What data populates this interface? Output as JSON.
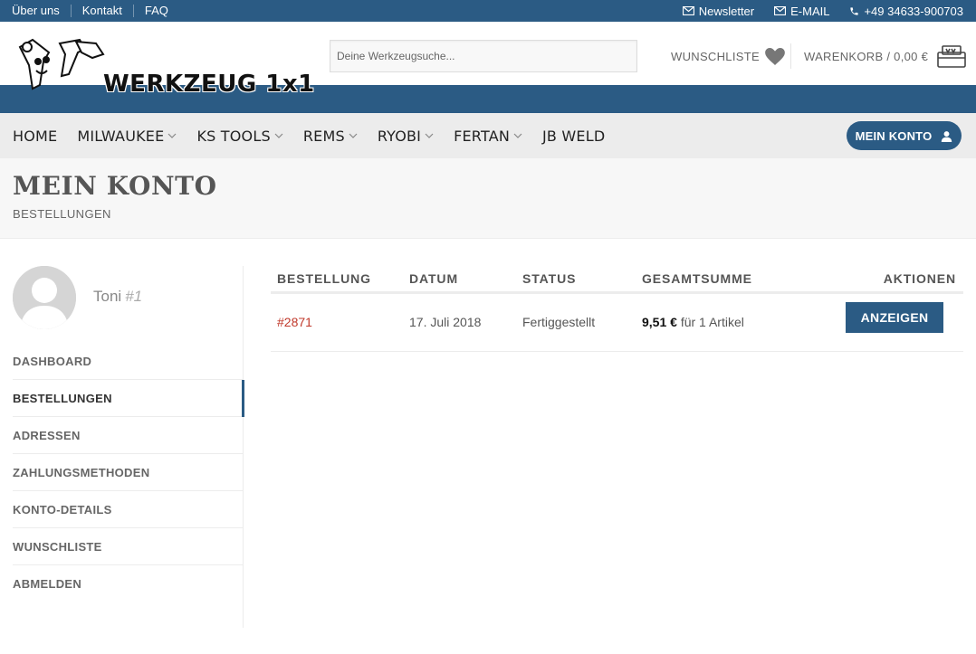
{
  "topbar": {
    "links": [
      "Über uns",
      "Kontakt",
      "FAQ"
    ],
    "newsletter": "Newsletter",
    "email": "E-MAIL",
    "phone": "+49 34633-900703"
  },
  "header": {
    "logo_text": "WERKZEUG 1x1",
    "search_placeholder": "Deine Werkzeugsuche...",
    "wishlist_label": "WUNSCHLISTE",
    "cart_label": "WARENKORB / 0,00 €"
  },
  "nav": {
    "items": [
      {
        "label": "HOME",
        "has_dropdown": false
      },
      {
        "label": "MILWAUKEE",
        "has_dropdown": true
      },
      {
        "label": "KS TOOLS",
        "has_dropdown": true
      },
      {
        "label": "REMS",
        "has_dropdown": true
      },
      {
        "label": "RYOBI",
        "has_dropdown": true
      },
      {
        "label": "FERTAN",
        "has_dropdown": true
      },
      {
        "label": "JB WELD",
        "has_dropdown": false
      }
    ],
    "account_button": "MEIN KONTO"
  },
  "page": {
    "title": "MEIN KONTO",
    "subtitle": "BESTELLUNGEN"
  },
  "user": {
    "name": "Toni",
    "id": "#1"
  },
  "account_menu": {
    "items": [
      "DASHBOARD",
      "BESTELLUNGEN",
      "ADRESSEN",
      "ZAHLUNGSMETHODEN",
      "KONTO-DETAILS",
      "WUNSCHLISTE",
      "ABMELDEN"
    ],
    "active_index": 1
  },
  "orders": {
    "headers": [
      "BESTELLUNG",
      "DATUM",
      "STATUS",
      "GESAMTSUMME",
      "AKTIONEN"
    ],
    "rows": [
      {
        "order": "#2871",
        "date": "17. Juli 2018",
        "status": "Fertiggestellt",
        "amount": "9,51 €",
        "items": "für 1 Artikel",
        "action": "ANZEIGEN"
      }
    ]
  },
  "colors": {
    "primary": "#2b5b84",
    "link": "#c0392b",
    "nav_bg": "#ececec"
  }
}
